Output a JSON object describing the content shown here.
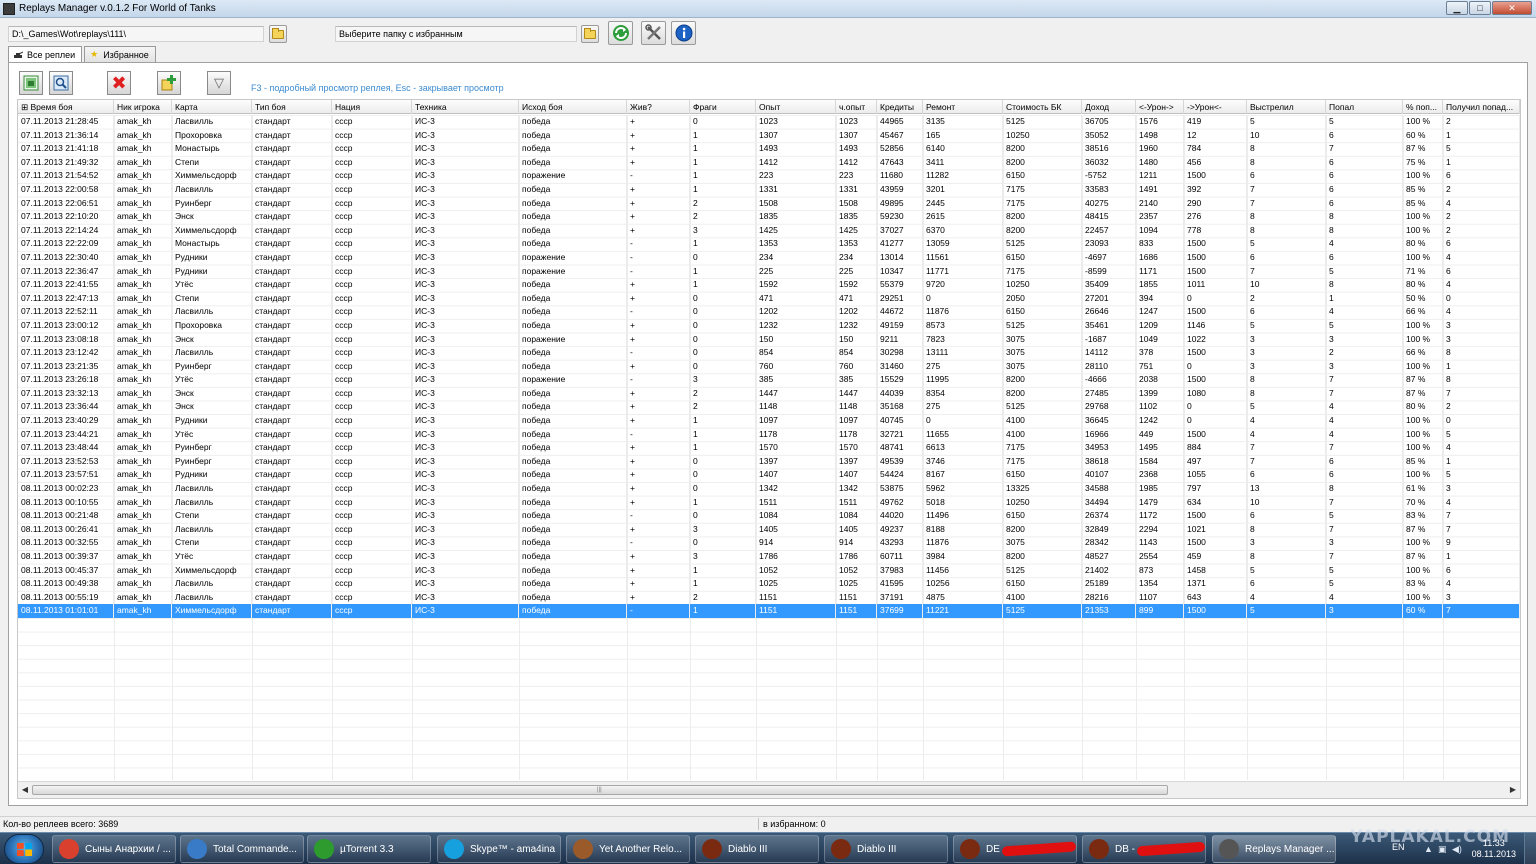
{
  "window": {
    "title": "Replays Manager v.0.1.2 For World of Tanks",
    "minimize": "▁",
    "maximize": "□",
    "close": "✕"
  },
  "pathbar": {
    "replays_path": "D:\\_Games\\Wot\\replays\\111\\",
    "favorites_path": "Выберите папку с избранным"
  },
  "tabs": [
    {
      "label": "Все реплеи",
      "active": true
    },
    {
      "label": "Избранное",
      "active": false
    }
  ],
  "toolbar": {
    "hint": "F3 - подробный просмотр реплея, Esc - закрывает просмотр"
  },
  "table": {
    "columns": [
      "Время боя",
      "Ник игрока",
      "Карта",
      "Тип боя",
      "Нация",
      "Техника",
      "Исход боя",
      "Жив?",
      "Фраги",
      "Опыт",
      "ч.опыт",
      "Кредиты",
      "Ремонт",
      "Стоимость БК",
      "Доход",
      "<-Урон->",
      "->Урон<-",
      "Выстрелил",
      "Попал",
      "% поп...",
      "Получил попад..."
    ],
    "rows": [
      [
        "07.11.2013 21:28:45",
        "amak_kh",
        "Ласвилль",
        "стандарт",
        "ссср",
        "ИС-3",
        "победа",
        "+",
        "0",
        "1023",
        "1023",
        "44965",
        "3135",
        "5125",
        "36705",
        "1576",
        "419",
        "5",
        "5",
        "100 %",
        "2"
      ],
      [
        "07.11.2013 21:36:14",
        "amak_kh",
        "Прохоровка",
        "стандарт",
        "ссср",
        "ИС-3",
        "победа",
        "+",
        "1",
        "1307",
        "1307",
        "45467",
        "165",
        "10250",
        "35052",
        "1498",
        "12",
        "10",
        "6",
        "60 %",
        "1"
      ],
      [
        "07.11.2013 21:41:18",
        "amak_kh",
        "Монастырь",
        "стандарт",
        "ссср",
        "ИС-3",
        "победа",
        "+",
        "1",
        "1493",
        "1493",
        "52856",
        "6140",
        "8200",
        "38516",
        "1960",
        "784",
        "8",
        "7",
        "87 %",
        "5"
      ],
      [
        "07.11.2013 21:49:32",
        "amak_kh",
        "Степи",
        "стандарт",
        "ссср",
        "ИС-3",
        "победа",
        "+",
        "1",
        "1412",
        "1412",
        "47643",
        "3411",
        "8200",
        "36032",
        "1480",
        "456",
        "8",
        "6",
        "75 %",
        "1"
      ],
      [
        "07.11.2013 21:54:52",
        "amak_kh",
        "Химмельсдорф",
        "стандарт",
        "ссср",
        "ИС-3",
        "поражение",
        "-",
        "1",
        "223",
        "223",
        "11680",
        "11282",
        "6150",
        "-5752",
        "1211",
        "1500",
        "6",
        "6",
        "100 %",
        "6"
      ],
      [
        "07.11.2013 22:00:58",
        "amak_kh",
        "Ласвилль",
        "стандарт",
        "ссср",
        "ИС-3",
        "победа",
        "+",
        "1",
        "1331",
        "1331",
        "43959",
        "3201",
        "7175",
        "33583",
        "1491",
        "392",
        "7",
        "6",
        "85 %",
        "2"
      ],
      [
        "07.11.2013 22:06:51",
        "amak_kh",
        "Руинберг",
        "стандарт",
        "ссср",
        "ИС-3",
        "победа",
        "+",
        "2",
        "1508",
        "1508",
        "49895",
        "2445",
        "7175",
        "40275",
        "2140",
        "290",
        "7",
        "6",
        "85 %",
        "4"
      ],
      [
        "07.11.2013 22:10:20",
        "amak_kh",
        "Энск",
        "стандарт",
        "ссср",
        "ИС-3",
        "победа",
        "+",
        "2",
        "1835",
        "1835",
        "59230",
        "2615",
        "8200",
        "48415",
        "2357",
        "276",
        "8",
        "8",
        "100 %",
        "2"
      ],
      [
        "07.11.2013 22:14:24",
        "amak_kh",
        "Химмельсдорф",
        "стандарт",
        "ссср",
        "ИС-3",
        "победа",
        "+",
        "3",
        "1425",
        "1425",
        "37027",
        "6370",
        "8200",
        "22457",
        "1094",
        "778",
        "8",
        "8",
        "100 %",
        "2"
      ],
      [
        "07.11.2013 22:22:09",
        "amak_kh",
        "Монастырь",
        "стандарт",
        "ссср",
        "ИС-3",
        "победа",
        "-",
        "1",
        "1353",
        "1353",
        "41277",
        "13059",
        "5125",
        "23093",
        "833",
        "1500",
        "5",
        "4",
        "80 %",
        "6"
      ],
      [
        "07.11.2013 22:30:40",
        "amak_kh",
        "Рудники",
        "стандарт",
        "ссср",
        "ИС-3",
        "поражение",
        "-",
        "0",
        "234",
        "234",
        "13014",
        "11561",
        "6150",
        "-4697",
        "1686",
        "1500",
        "6",
        "6",
        "100 %",
        "4"
      ],
      [
        "07.11.2013 22:36:47",
        "amak_kh",
        "Рудники",
        "стандарт",
        "ссср",
        "ИС-3",
        "поражение",
        "-",
        "1",
        "225",
        "225",
        "10347",
        "11771",
        "7175",
        "-8599",
        "1171",
        "1500",
        "7",
        "5",
        "71 %",
        "6"
      ],
      [
        "07.11.2013 22:41:55",
        "amak_kh",
        "Утёс",
        "стандарт",
        "ссср",
        "ИС-3",
        "победа",
        "+",
        "1",
        "1592",
        "1592",
        "55379",
        "9720",
        "10250",
        "35409",
        "1855",
        "1011",
        "10",
        "8",
        "80 %",
        "4"
      ],
      [
        "07.11.2013 22:47:13",
        "amak_kh",
        "Степи",
        "стандарт",
        "ссср",
        "ИС-3",
        "победа",
        "+",
        "0",
        "471",
        "471",
        "29251",
        "0",
        "2050",
        "27201",
        "394",
        "0",
        "2",
        "1",
        "50 %",
        "0"
      ],
      [
        "07.11.2013 22:52:11",
        "amak_kh",
        "Ласвилль",
        "стандарт",
        "ссср",
        "ИС-3",
        "победа",
        "-",
        "0",
        "1202",
        "1202",
        "44672",
        "11876",
        "6150",
        "26646",
        "1247",
        "1500",
        "6",
        "4",
        "66 %",
        "4"
      ],
      [
        "07.11.2013 23:00:12",
        "amak_kh",
        "Прохоровка",
        "стандарт",
        "ссср",
        "ИС-3",
        "победа",
        "+",
        "0",
        "1232",
        "1232",
        "49159",
        "8573",
        "5125",
        "35461",
        "1209",
        "1146",
        "5",
        "5",
        "100 %",
        "3"
      ],
      [
        "07.11.2013 23:08:18",
        "amak_kh",
        "Энск",
        "стандарт",
        "ссср",
        "ИС-3",
        "поражение",
        "+",
        "0",
        "150",
        "150",
        "9211",
        "7823",
        "3075",
        "-1687",
        "1049",
        "1022",
        "3",
        "3",
        "100 %",
        "3"
      ],
      [
        "07.11.2013 23:12:42",
        "amak_kh",
        "Ласвилль",
        "стандарт",
        "ссср",
        "ИС-3",
        "победа",
        "-",
        "0",
        "854",
        "854",
        "30298",
        "13111",
        "3075",
        "14112",
        "378",
        "1500",
        "3",
        "2",
        "66 %",
        "8"
      ],
      [
        "07.11.2013 23:21:35",
        "amak_kh",
        "Руинберг",
        "стандарт",
        "ссср",
        "ИС-3",
        "победа",
        "+",
        "0",
        "760",
        "760",
        "31460",
        "275",
        "3075",
        "28110",
        "751",
        "0",
        "3",
        "3",
        "100 %",
        "1"
      ],
      [
        "07.11.2013 23:26:18",
        "amak_kh",
        "Утёс",
        "стандарт",
        "ссср",
        "ИС-3",
        "поражение",
        "-",
        "3",
        "385",
        "385",
        "15529",
        "11995",
        "8200",
        "-4666",
        "2038",
        "1500",
        "8",
        "7",
        "87 %",
        "8"
      ],
      [
        "07.11.2013 23:32:13",
        "amak_kh",
        "Энск",
        "стандарт",
        "ссср",
        "ИС-3",
        "победа",
        "+",
        "2",
        "1447",
        "1447",
        "44039",
        "8354",
        "8200",
        "27485",
        "1399",
        "1080",
        "8",
        "7",
        "87 %",
        "7"
      ],
      [
        "07.11.2013 23:36:44",
        "amak_kh",
        "Энск",
        "стандарт",
        "ссср",
        "ИС-3",
        "победа",
        "+",
        "2",
        "1148",
        "1148",
        "35168",
        "275",
        "5125",
        "29768",
        "1102",
        "0",
        "5",
        "4",
        "80 %",
        "2"
      ],
      [
        "07.11.2013 23:40:29",
        "amak_kh",
        "Рудники",
        "стандарт",
        "ссср",
        "ИС-3",
        "победа",
        "+",
        "1",
        "1097",
        "1097",
        "40745",
        "0",
        "4100",
        "36645",
        "1242",
        "0",
        "4",
        "4",
        "100 %",
        "0"
      ],
      [
        "07.11.2013 23:44:21",
        "amak_kh",
        "Утёс",
        "стандарт",
        "ссср",
        "ИС-3",
        "победа",
        "-",
        "1",
        "1178",
        "1178",
        "32721",
        "11655",
        "4100",
        "16966",
        "449",
        "1500",
        "4",
        "4",
        "100 %",
        "5"
      ],
      [
        "07.11.2013 23:48:44",
        "amak_kh",
        "Руинберг",
        "стандарт",
        "ссср",
        "ИС-3",
        "победа",
        "+",
        "1",
        "1570",
        "1570",
        "48741",
        "6613",
        "7175",
        "34953",
        "1495",
        "884",
        "7",
        "7",
        "100 %",
        "4"
      ],
      [
        "07.11.2013 23:52:53",
        "amak_kh",
        "Руинберг",
        "стандарт",
        "ссср",
        "ИС-3",
        "победа",
        "+",
        "0",
        "1397",
        "1397",
        "49539",
        "3746",
        "7175",
        "38618",
        "1584",
        "497",
        "7",
        "6",
        "85 %",
        "1"
      ],
      [
        "07.11.2013 23:57:51",
        "amak_kh",
        "Рудники",
        "стандарт",
        "ссср",
        "ИС-3",
        "победа",
        "+",
        "0",
        "1407",
        "1407",
        "54424",
        "8167",
        "6150",
        "40107",
        "2368",
        "1055",
        "6",
        "6",
        "100 %",
        "5"
      ],
      [
        "08.11.2013 00:02:23",
        "amak_kh",
        "Ласвилль",
        "стандарт",
        "ссср",
        "ИС-3",
        "победа",
        "+",
        "0",
        "1342",
        "1342",
        "53875",
        "5962",
        "13325",
        "34588",
        "1985",
        "797",
        "13",
        "8",
        "61 %",
        "3"
      ],
      [
        "08.11.2013 00:10:55",
        "amak_kh",
        "Ласвилль",
        "стандарт",
        "ссср",
        "ИС-3",
        "победа",
        "+",
        "1",
        "1511",
        "1511",
        "49762",
        "5018",
        "10250",
        "34494",
        "1479",
        "634",
        "10",
        "7",
        "70 %",
        "4"
      ],
      [
        "08.11.2013 00:21:48",
        "amak_kh",
        "Степи",
        "стандарт",
        "ссср",
        "ИС-3",
        "победа",
        "-",
        "0",
        "1084",
        "1084",
        "44020",
        "11496",
        "6150",
        "26374",
        "1172",
        "1500",
        "6",
        "5",
        "83 %",
        "7"
      ],
      [
        "08.11.2013 00:26:41",
        "amak_kh",
        "Ласвилль",
        "стандарт",
        "ссср",
        "ИС-3",
        "победа",
        "+",
        "3",
        "1405",
        "1405",
        "49237",
        "8188",
        "8200",
        "32849",
        "2294",
        "1021",
        "8",
        "7",
        "87 %",
        "7"
      ],
      [
        "08.11.2013 00:32:55",
        "amak_kh",
        "Степи",
        "стандарт",
        "ссср",
        "ИС-3",
        "победа",
        "-",
        "0",
        "914",
        "914",
        "43293",
        "11876",
        "3075",
        "28342",
        "1143",
        "1500",
        "3",
        "3",
        "100 %",
        "9"
      ],
      [
        "08.11.2013 00:39:37",
        "amak_kh",
        "Утёс",
        "стандарт",
        "ссср",
        "ИС-3",
        "победа",
        "+",
        "3",
        "1786",
        "1786",
        "60711",
        "3984",
        "8200",
        "48527",
        "2554",
        "459",
        "8",
        "7",
        "87 %",
        "1"
      ],
      [
        "08.11.2013 00:45:37",
        "amak_kh",
        "Химмельсдорф",
        "стандарт",
        "ссср",
        "ИС-3",
        "победа",
        "+",
        "1",
        "1052",
        "1052",
        "37983",
        "11456",
        "5125",
        "21402",
        "873",
        "1458",
        "5",
        "5",
        "100 %",
        "6"
      ],
      [
        "08.11.2013 00:49:38",
        "amak_kh",
        "Ласвилль",
        "стандарт",
        "ссср",
        "ИС-3",
        "победа",
        "+",
        "1",
        "1025",
        "1025",
        "41595",
        "10256",
        "6150",
        "25189",
        "1354",
        "1371",
        "6",
        "5",
        "83 %",
        "4"
      ],
      [
        "08.11.2013 00:55:19",
        "amak_kh",
        "Ласвилль",
        "стандарт",
        "ссср",
        "ИС-3",
        "победа",
        "+",
        "2",
        "1151",
        "1151",
        "37191",
        "4875",
        "4100",
        "28216",
        "1107",
        "643",
        "4",
        "4",
        "100 %",
        "3"
      ],
      [
        "08.11.2013 01:01:01",
        "amak_kh",
        "Химмельсдорф",
        "стандарт",
        "ссср",
        "ИС-3",
        "победа",
        "-",
        "1",
        "1151",
        "1151",
        "37699",
        "11221",
        "5125",
        "21353",
        "899",
        "1500",
        "5",
        "3",
        "60 %",
        "7"
      ]
    ],
    "selected_row": 36
  },
  "status": {
    "total": "Кол-во реплеев всего: 3689",
    "favorites": "в избранном: 0"
  },
  "taskbar": {
    "tasks": [
      {
        "label": "Сыны Анархии / ...",
        "icon": "chrome-icon",
        "color": "#d9412e"
      },
      {
        "label": "Total Commande...",
        "icon": "total-commander-icon",
        "color": "#3a7bc8"
      },
      {
        "label": "µTorrent 3.3",
        "icon": "utorrent-icon",
        "color": "#2e9b2e"
      },
      {
        "label": "Skype™ - ama4ina",
        "icon": "skype-icon",
        "color": "#17a0de"
      },
      {
        "label": "Yet Another Relo...",
        "icon": "jar-icon",
        "color": "#9a5a2a"
      },
      {
        "label": "Diablo III",
        "icon": "diablo-icon",
        "color": "#7a2a10"
      },
      {
        "label": "Diablo III",
        "icon": "diablo-icon",
        "color": "#7a2a10"
      },
      {
        "label": "DE",
        "icon": "diablo-icon",
        "color": "#7a2a10"
      },
      {
        "label": "DB -",
        "icon": "diablo-icon",
        "color": "#7a2a10"
      },
      {
        "label": "Replays Manager ...",
        "icon": "wot-icon",
        "color": "#555555"
      }
    ],
    "lang": "EN",
    "time": "11:33",
    "date": "08.11.2013",
    "watermark": "YAPLAKAL.COM"
  }
}
